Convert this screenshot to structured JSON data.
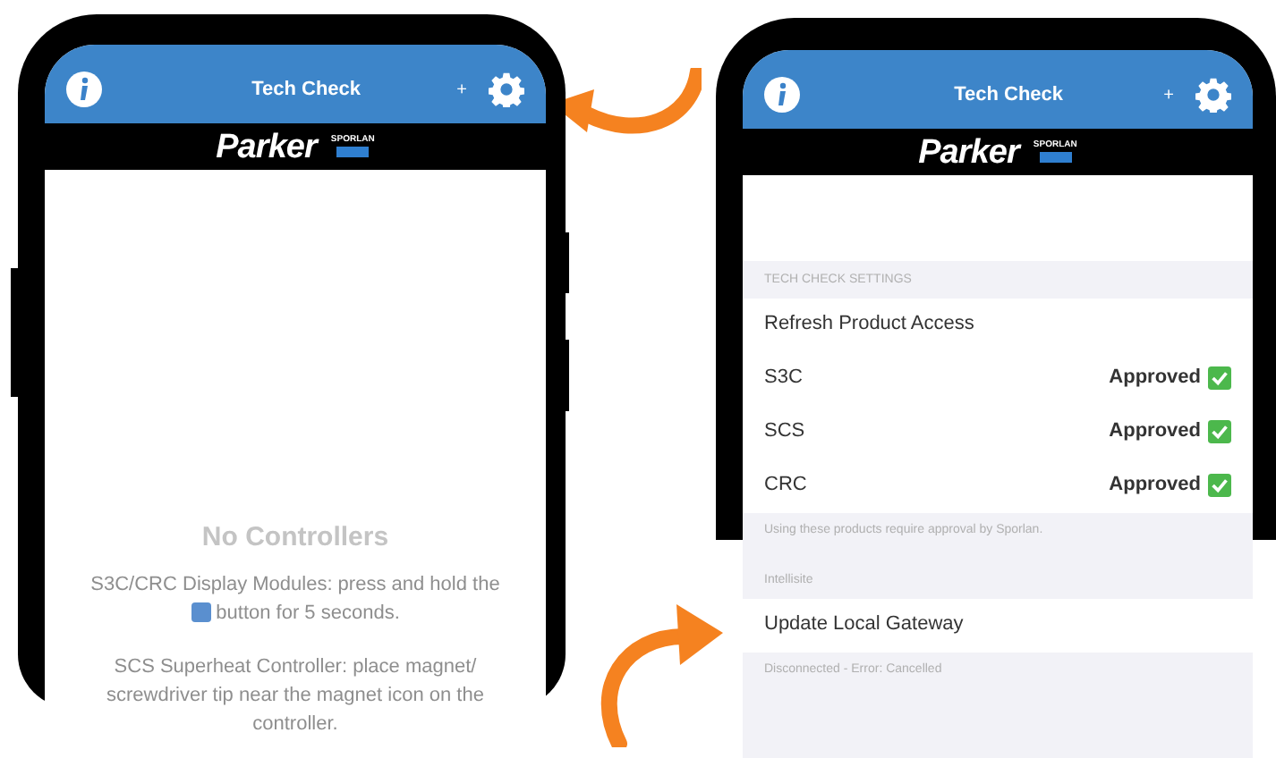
{
  "left_phone": {
    "header": {
      "title": "Tech Check",
      "add": "+"
    },
    "logo": {
      "brand": "Parker",
      "sub": "SPORLAN"
    },
    "empty_state": {
      "title": "No Controllers",
      "note_1_before": "S3C/CRC Display Modules: press and hold the",
      "note_1_after": "button for 5 seconds.",
      "note_2": "SCS Superheat Controller: place magnet/ screwdriver tip near the magnet icon on the controller."
    }
  },
  "right_phone": {
    "header": {
      "title": "Tech Check",
      "add": "+"
    },
    "logo": {
      "brand": "Parker",
      "sub": "SPORLAN"
    },
    "sections": [
      {
        "heading": "TECH CHECK SETTINGS",
        "rows": [
          {
            "kind": "action",
            "label": "Refresh Product Access"
          },
          {
            "kind": "status",
            "label": "S3C",
            "status": "Approved",
            "checked": true
          },
          {
            "kind": "status",
            "label": "SCS",
            "status": "Approved",
            "checked": true
          },
          {
            "kind": "status",
            "label": "CRC",
            "status": "Approved",
            "checked": true
          }
        ],
        "footer": "Using these products require approval by Sporlan."
      },
      {
        "heading": "Intellisite",
        "rows": [
          {
            "kind": "action",
            "label": "Update Local Gateway"
          }
        ],
        "footer": "Disconnected - Error: Cancelled"
      }
    ]
  }
}
